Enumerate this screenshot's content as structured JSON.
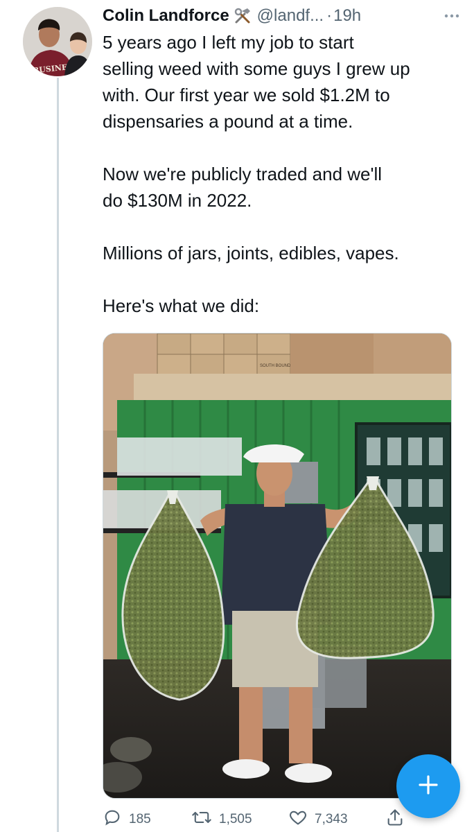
{
  "tweet": {
    "author_name": "Colin Landforce",
    "author_badge_icon": "hammer-wrench-icon",
    "handle": "@landf...",
    "separator": "·",
    "time": "19h",
    "paragraphs": [
      "5 years ago I left my job to start\nselling weed with some guys I grew up\nwith. Our first year we sold $1.2M to\ndispensaries a pound at a time.",
      "Now we're publicly traded and we'll\ndo $130M in 2022.",
      "Millions of jars, joints, edibles, vapes.",
      "Here's what we did:"
    ],
    "avatar_shirt_text": "BUSINESS",
    "photo_box_text": "SOUTH BOUND"
  },
  "actions": {
    "replies": "185",
    "retweets": "1,505",
    "likes": "7,343"
  },
  "icons": {
    "reply": "reply-icon",
    "retweet": "retweet-icon",
    "like": "heart-icon",
    "share": "share-icon",
    "more": "more-options-icon",
    "compose": "plus-icon"
  },
  "colors": {
    "accent": "#1d9bf0",
    "text": "#0f1419",
    "muted": "#536471"
  }
}
